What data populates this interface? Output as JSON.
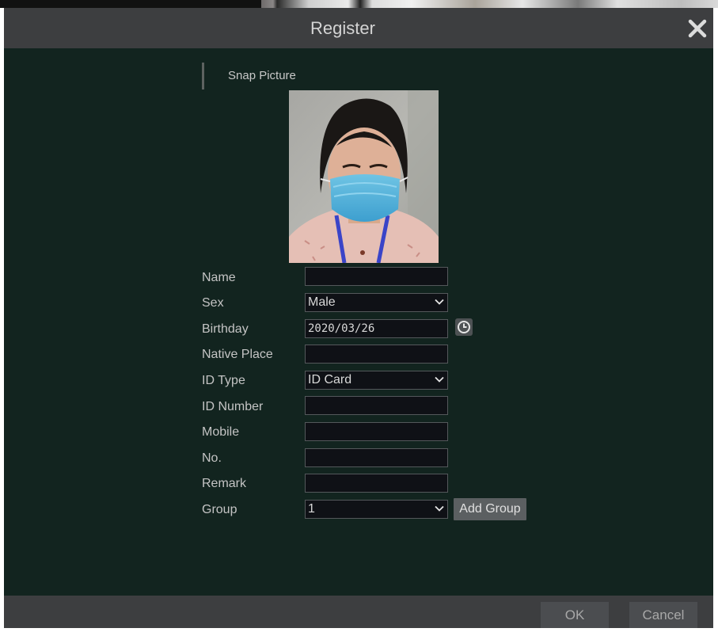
{
  "dialog": {
    "title": "Register",
    "section_title": "Snap Picture"
  },
  "form": {
    "name": {
      "label": "Name",
      "value": ""
    },
    "sex": {
      "label": "Sex",
      "value": "Male"
    },
    "birthday": {
      "label": "Birthday",
      "value": "2020/03/26"
    },
    "native_place": {
      "label": "Native Place",
      "value": ""
    },
    "id_type": {
      "label": "ID Type",
      "value": "ID Card"
    },
    "id_number": {
      "label": "ID Number",
      "value": ""
    },
    "mobile": {
      "label": "Mobile",
      "value": ""
    },
    "no": {
      "label": "No.",
      "value": ""
    },
    "remark": {
      "label": "Remark",
      "value": ""
    },
    "group": {
      "label": "Group",
      "value": "1",
      "add_button": "Add Group"
    }
  },
  "footer": {
    "ok_label": "OK",
    "cancel_label": "Cancel"
  },
  "icons": {
    "close": "close-icon",
    "calendar": "clock-icon",
    "dropdown": "chevron-down-icon"
  },
  "colors": {
    "dialog_bg": "#12241f",
    "bar_bg": "#3d3e40",
    "field_bg": "#0f1116"
  }
}
